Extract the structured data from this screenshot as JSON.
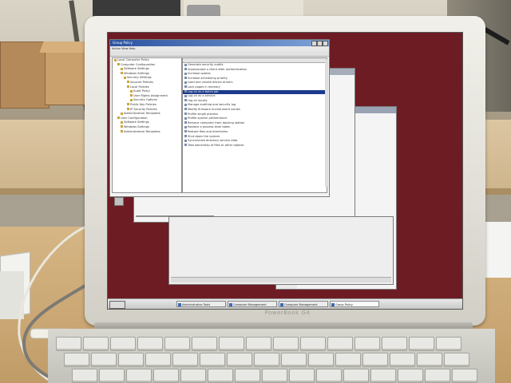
{
  "laptop": {
    "brand_label": "PowerBook G4"
  },
  "desktop": {
    "taskbar": {
      "tasks": [
        {
          "label": "Administrative Tools"
        },
        {
          "label": "Computer Management"
        },
        {
          "label": "Computer Management"
        },
        {
          "label": "Group Policy"
        }
      ]
    }
  },
  "windows": {
    "group_policy": {
      "title": "Group Policy",
      "menu": "Action  View  Help",
      "tree_items": [
        "Local Computer Policy",
        "Computer Configuration",
        "Software Settings",
        "Windows Settings",
        "Security Settings",
        "Account Policies",
        "Local Policies",
        "Audit Policy",
        "User Rights Assignment",
        "Security Options",
        "Public Key Policies",
        "IP Security Policies",
        "Administrative Templates",
        "User Configuration",
        "Software Settings",
        "Windows Settings",
        "Administrative Templates"
      ],
      "list_items": [
        "Generate security audits",
        "Impersonate a client after authentication",
        "Increase quotas",
        "Increase scheduling priority",
        "Load and unload device drivers",
        "Lock pages in memory",
        "Log on as a batch job",
        "Log on as a service",
        "Log on locally",
        "Manage auditing and security log",
        "Modify firmware environment values",
        "Profile single process",
        "Profile system performance",
        "Remove computer from docking station",
        "Replace a process level token",
        "Restore files and directories",
        "Shut down the system",
        "Synchronize directory service data",
        "Take ownership of files or other objects"
      ],
      "selected_list_index": 6
    }
  }
}
